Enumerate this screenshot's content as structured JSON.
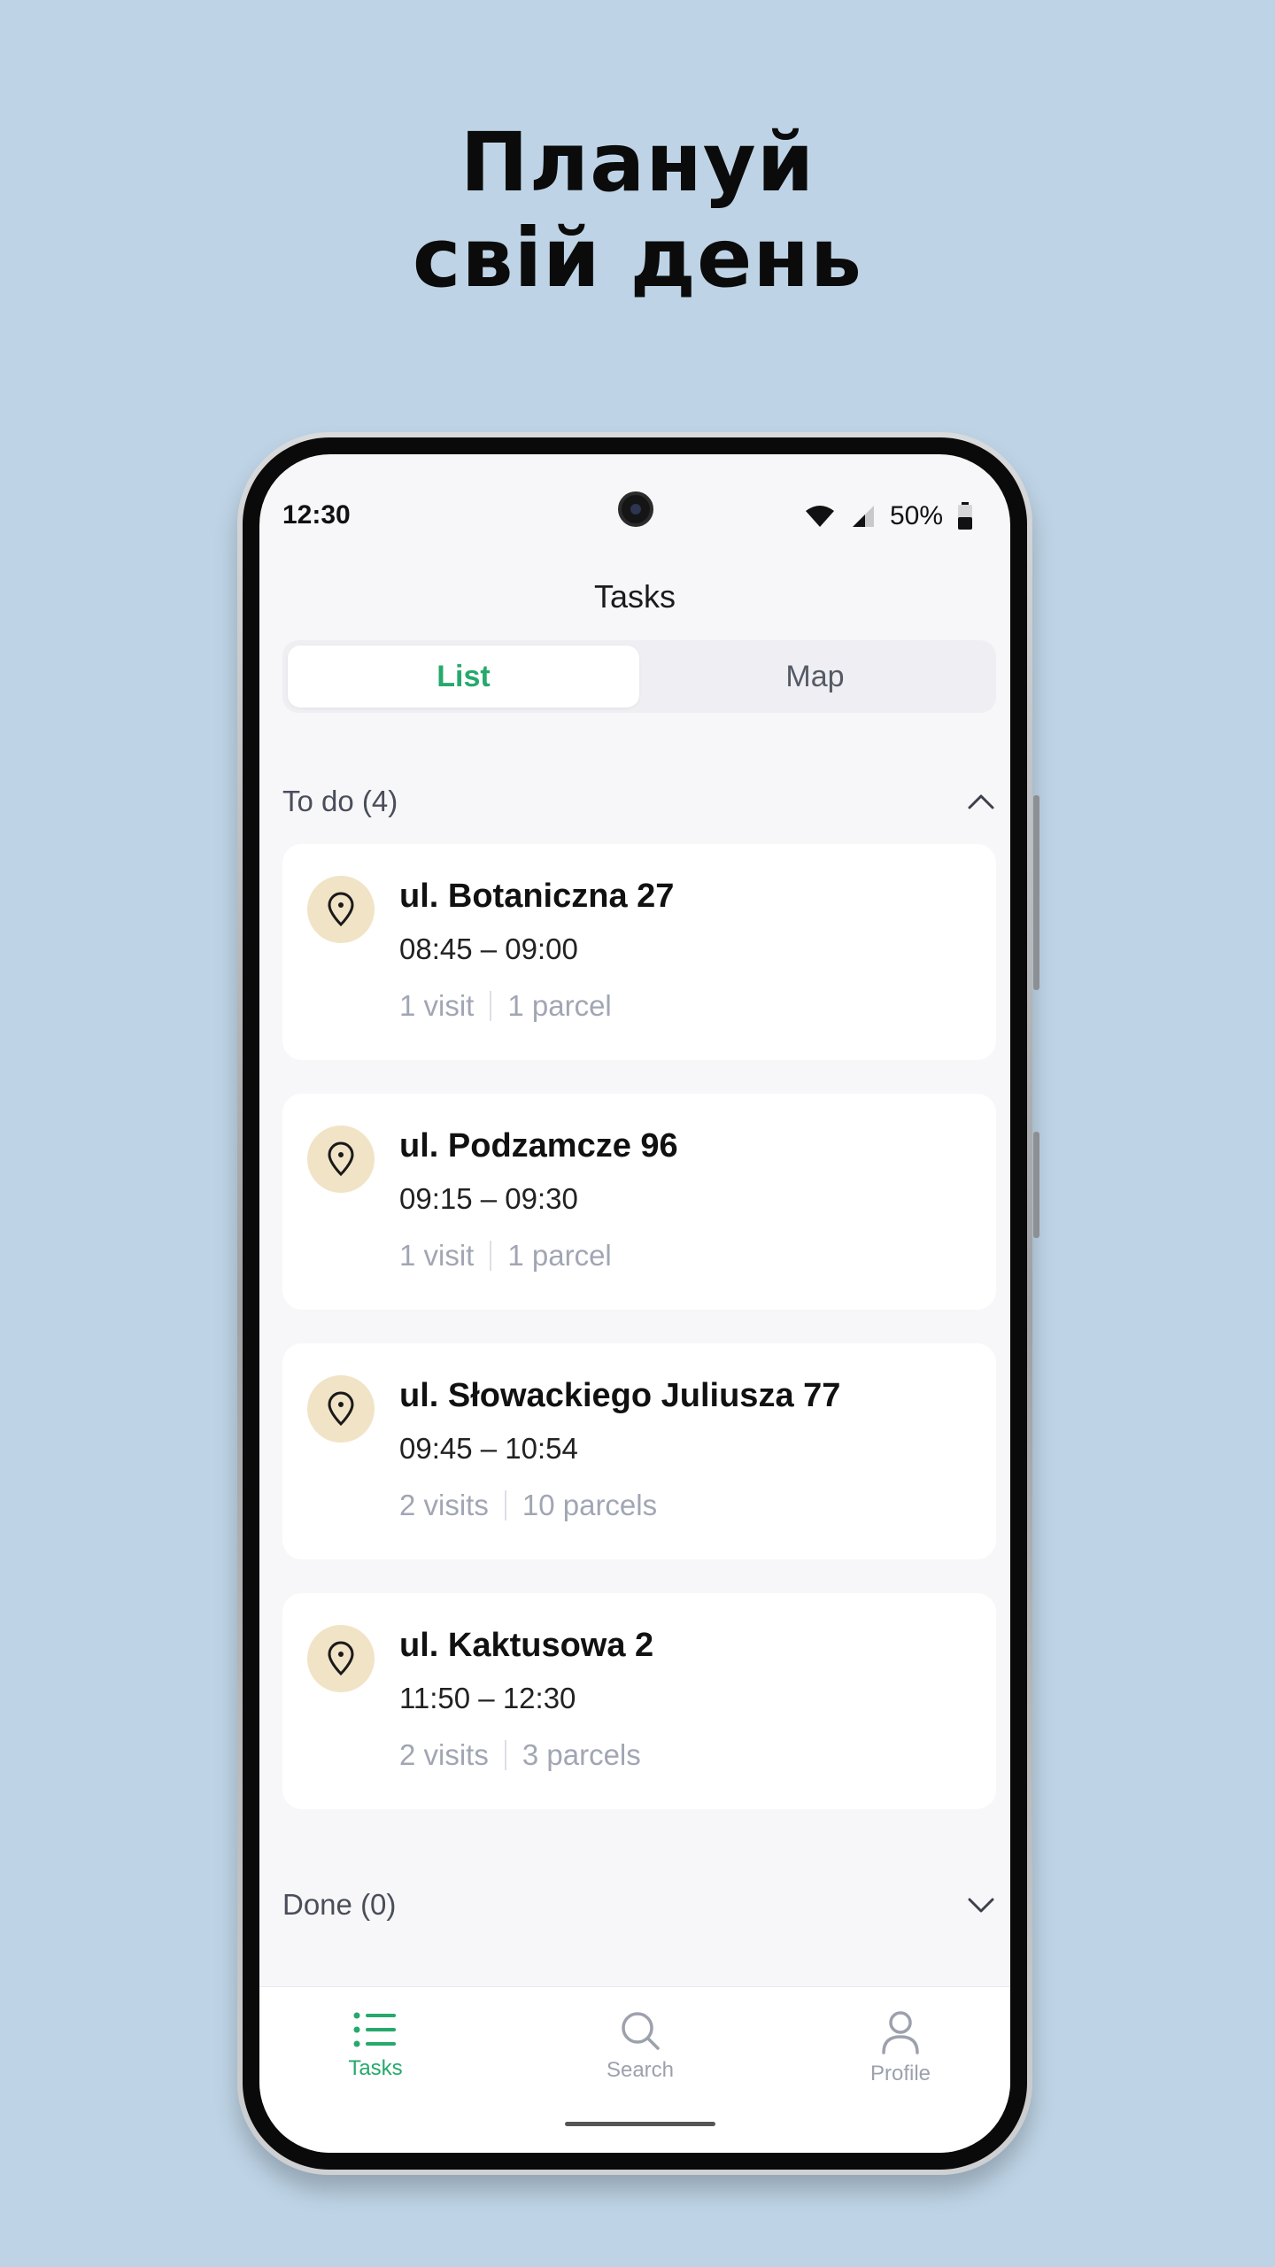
{
  "headline": {
    "line1": "Плануй",
    "line2": "свій день"
  },
  "status_bar": {
    "time": "12:30",
    "battery": "50%"
  },
  "app": {
    "title": "Tasks"
  },
  "segmented": {
    "list": "List",
    "map": "Map"
  },
  "sections": {
    "todo": {
      "label": "To do",
      "count": "(4)"
    },
    "done": {
      "label": "Done",
      "count": "(0)"
    }
  },
  "tasks": [
    {
      "address": "ul. Botaniczna 27",
      "time": "08:45 – 09:00",
      "visits": "1 visit",
      "parcels": "1 parcel"
    },
    {
      "address": "ul. Podzamcze 96",
      "time": "09:15 – 09:30",
      "visits": "1 visit",
      "parcels": "1 parcel"
    },
    {
      "address": "ul. Słowackiego Juliusza 77",
      "time": "09:45 – 10:54",
      "visits": "2 visits",
      "parcels": "10 parcels"
    },
    {
      "address": "ul. Kaktusowa 2",
      "time": "11:50 – 12:30",
      "visits": "2 visits",
      "parcels": "3 parcels"
    }
  ],
  "nav": {
    "tasks": "Tasks",
    "search": "Search",
    "profile": "Profile"
  },
  "colors": {
    "accent": "#26a96c",
    "background": "#bed4e6",
    "pin_bg": "#f1e3c6"
  },
  "icons": {
    "pin": "map-pin-icon",
    "wifi": "wifi-icon",
    "signal": "signal-icon",
    "battery": "battery-icon",
    "list": "list-icon",
    "search": "search-icon",
    "profile": "person-icon"
  }
}
